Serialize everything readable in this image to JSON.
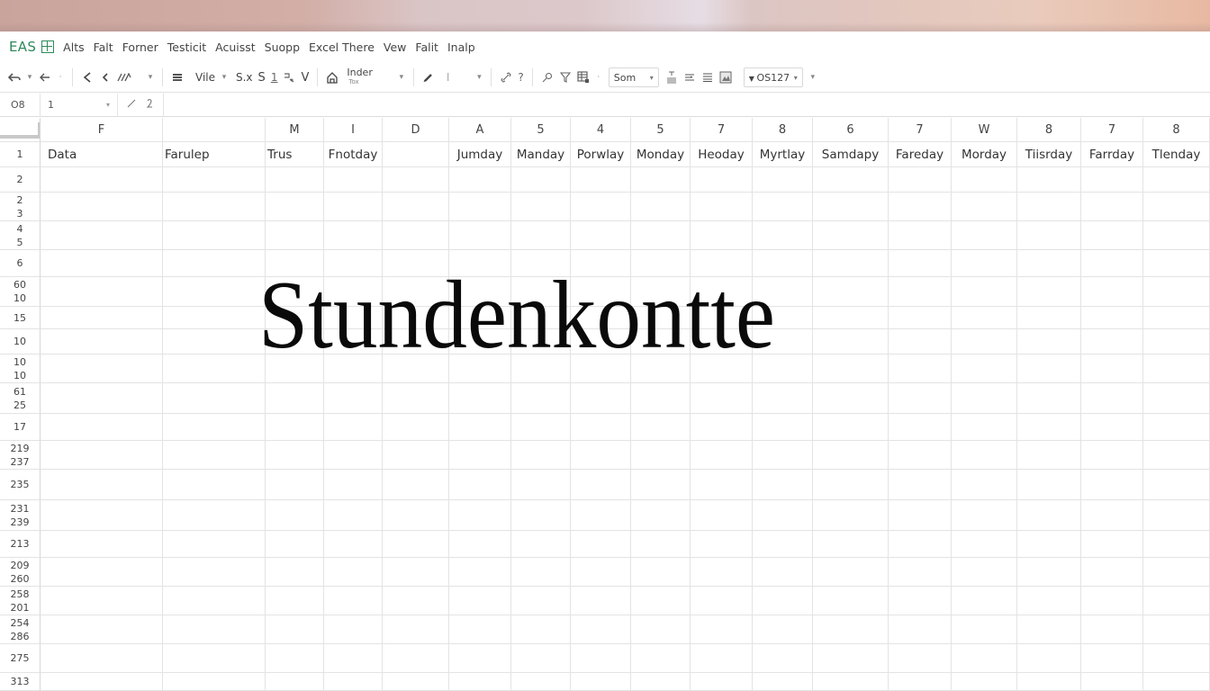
{
  "window": {
    "app_name": "EAS",
    "app_icon": "spreadsheet-grid-icon"
  },
  "menubar": {
    "items": [
      "Alts",
      "Falt",
      "Forner",
      "Testicit",
      "Acuisst",
      "Suopp",
      "Excel There",
      "Vew",
      "Falit",
      "Inalp"
    ]
  },
  "toolbar": {
    "icons": {
      "undo": "undo-icon",
      "redo": "redo-icon",
      "back": "chevron-left-icon",
      "back_small": "chevron-left-small-icon",
      "format_painter": "format-painter-icon",
      "align": "align-icon",
      "underline": "underline-icon",
      "borders": "borders-icon",
      "fill": "fill-icon",
      "home": "home-icon",
      "pen": "pen-icon",
      "link": "link-icon",
      "help": "help-icon",
      "find": "find-icon",
      "filter": "filter-icon",
      "table": "table-icon",
      "text_format": "text-format-icon",
      "wrap": "wrap-icon",
      "lines": "lines-icon",
      "image": "image-icon"
    },
    "font_label": "Vile",
    "style_sx": "S.x",
    "style_s": "S",
    "style_1": "1",
    "style_v": "V",
    "inder_label": "Inder",
    "inder_sub": "Tox",
    "size_placeholder": "I",
    "sort_select": "Som",
    "number_select": "OS127"
  },
  "formula_bar": {
    "name_box": "O8",
    "function_select": "1",
    "formula": ""
  },
  "sheet": {
    "column_headers": [
      "F",
      "",
      "M",
      "I",
      "D",
      "A",
      "5",
      "4",
      "5",
      "7",
      "8",
      "6",
      "7",
      "W",
      "8",
      "7",
      "8"
    ],
    "row1": [
      "Data",
      "Farulep",
      "Trus",
      "Fnotday",
      "",
      "Jumday",
      "Manday",
      "Porwlay",
      "Monday",
      "Heoday",
      "Myrtlay",
      "Samdapy",
      "Fareday",
      "Morday",
      "Tiisrday",
      "Farrday",
      "Tlenday"
    ],
    "row_headers": [
      [
        "1"
      ],
      [
        "2"
      ],
      [
        "2",
        "3"
      ],
      [
        "4",
        "5"
      ],
      [
        "6"
      ],
      [
        "60",
        "10"
      ],
      [
        "15"
      ],
      [
        "10"
      ],
      [
        "10",
        "10"
      ],
      [
        "61",
        "25"
      ],
      [
        "17"
      ],
      [
        "219",
        "237"
      ],
      [
        "235"
      ],
      [
        "231",
        "239"
      ],
      [
        "213"
      ],
      [
        "209",
        "260"
      ],
      [
        "258",
        "201"
      ],
      [
        "254",
        "286"
      ],
      [
        "275"
      ],
      [
        "313"
      ]
    ]
  },
  "overlay_title": "Stundenkontte"
}
